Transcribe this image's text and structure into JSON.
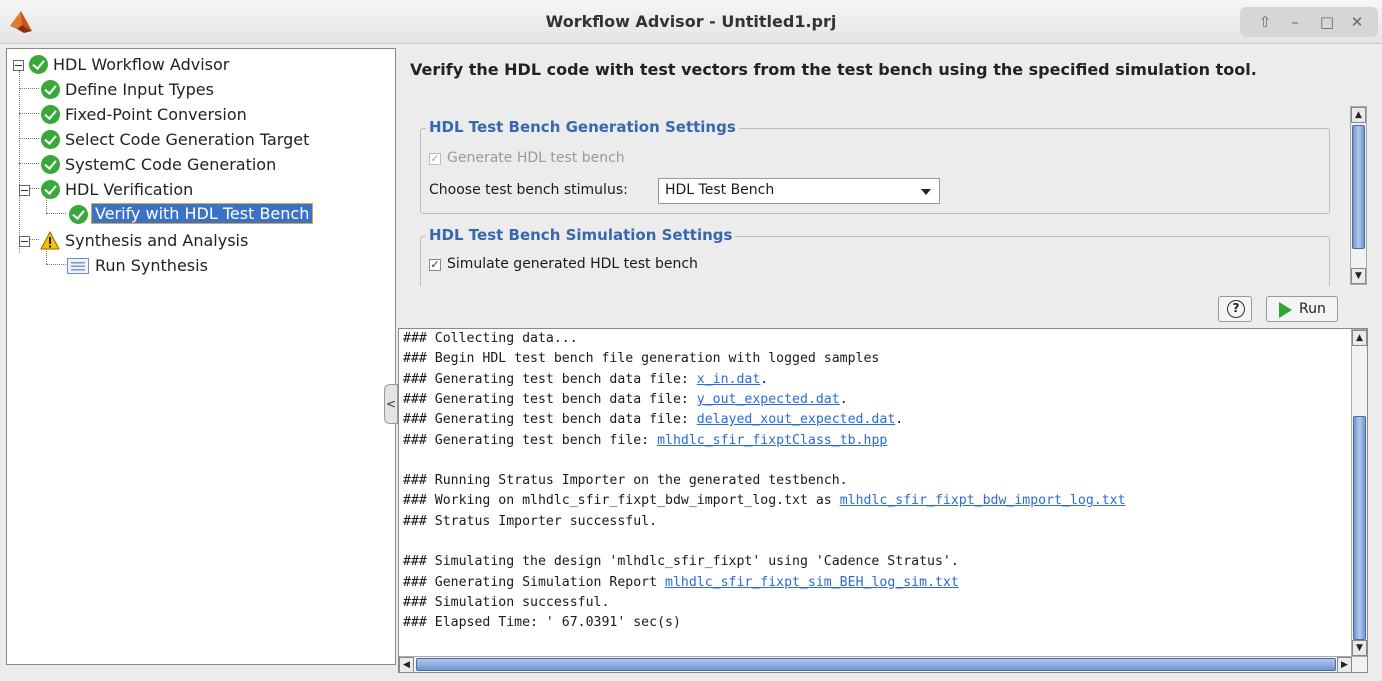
{
  "window": {
    "title": "Workflow Advisor - Untitled1.prj",
    "controls": [
      "up-icon",
      "minimize-icon",
      "maximize-icon",
      "close-icon"
    ]
  },
  "tree": {
    "root": {
      "label": "HDL Workflow Advisor",
      "status": "passed"
    },
    "items": [
      {
        "label": "Define Input Types",
        "status": "passed"
      },
      {
        "label": "Fixed-Point Conversion",
        "status": "passed"
      },
      {
        "label": "Select Code Generation Target",
        "status": "passed"
      },
      {
        "label": "SystemC Code Generation",
        "status": "passed"
      },
      {
        "label": "HDL Verification",
        "status": "passed"
      },
      {
        "label": "Verify with HDL Test Bench",
        "status": "passed",
        "selected": true
      },
      {
        "label": "Synthesis and Analysis",
        "status": "warning"
      },
      {
        "label": "Run Synthesis",
        "status": "not-run"
      }
    ]
  },
  "task": {
    "heading": "Verify the HDL code with test vectors from the test bench using the specified simulation tool."
  },
  "settings": {
    "generation_group": {
      "title": "HDL Test Bench Generation Settings",
      "generate_checkbox_label": "Generate HDL test bench",
      "generate_checked": true,
      "stimulus_label": "Choose test bench stimulus:",
      "stimulus_value": "HDL Test Bench"
    },
    "simulation_group": {
      "title": "HDL Test Bench Simulation Settings",
      "simulate_checkbox_label": "Simulate generated HDL test bench",
      "simulate_checked": true
    }
  },
  "buttons": {
    "help_symbol": "?",
    "run_label": "Run"
  },
  "log": {
    "lines": [
      {
        "text": "### Collecting data..."
      },
      {
        "text": "### Begin HDL test bench file generation with logged samples"
      },
      {
        "text": "### Generating test bench data file: ",
        "link": "x_in.dat",
        "suffix": "."
      },
      {
        "text": "### Generating test bench data file: ",
        "link": "y_out_expected.dat",
        "suffix": "."
      },
      {
        "text": "### Generating test bench data file: ",
        "link": "delayed_xout_expected.dat",
        "suffix": "."
      },
      {
        "text": "### Generating test bench file: ",
        "link": "mlhdlc_sfir_fixptClass_tb.hpp",
        "suffix": ""
      },
      {
        "text": ""
      },
      {
        "text": "### Running Stratus Importer on the generated testbench."
      },
      {
        "text": "### Working on mlhdlc_sfir_fixpt_bdw_import_log.txt as ",
        "link": "mlhdlc_sfir_fixpt_bdw_import_log.txt",
        "suffix": ""
      },
      {
        "text": "### Stratus Importer successful."
      },
      {
        "text": ""
      },
      {
        "text": "### Simulating the design 'mlhdlc_sfir_fixpt' using 'Cadence Stratus'."
      },
      {
        "text": "### Generating Simulation Report ",
        "link": "mlhdlc_sfir_fixpt_sim_BEH_log_sim.txt",
        "suffix": ""
      },
      {
        "text": "### Simulation successful."
      },
      {
        "text": "### Elapsed Time: '           67.0391' sec(s)"
      }
    ]
  },
  "colors": {
    "accent_blue": "#3867b0",
    "selection_blue": "#3a72c8",
    "link_blue": "#2a6bd6",
    "pass_green": "#39a83a",
    "warning_yellow": "#f2c200"
  }
}
